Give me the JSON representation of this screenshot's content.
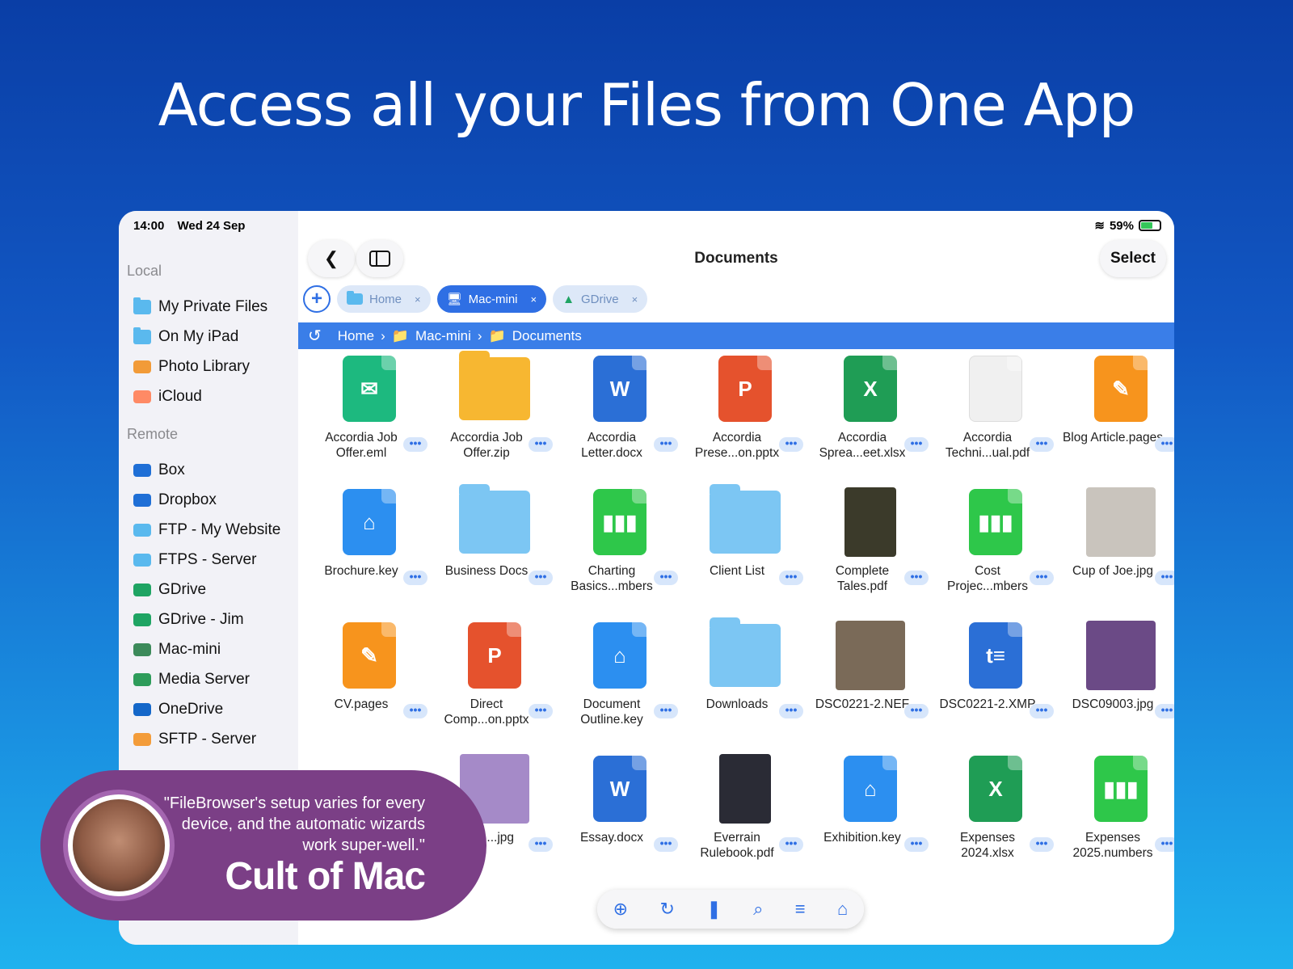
{
  "headline": "Access all your Files from One App",
  "status": {
    "time": "14:00",
    "date": "Wed 24 Sep",
    "battery": "59%"
  },
  "sidebar": {
    "local_title": "Local",
    "local_items": [
      {
        "label": "My Private Files",
        "icon": "folder-icon"
      },
      {
        "label": "On My iPad",
        "icon": "folder-icon"
      },
      {
        "label": "Photo Library",
        "icon": "photos-icon"
      },
      {
        "label": "iCloud",
        "icon": "cloud-icon"
      }
    ],
    "remote_title": "Remote",
    "remote_items": [
      {
        "label": "Box",
        "icon": "box-icon"
      },
      {
        "label": "Dropbox",
        "icon": "dropbox-icon"
      },
      {
        "label": "FTP - My Website",
        "icon": "ftp-icon"
      },
      {
        "label": "FTPS - Server",
        "icon": "ftps-icon"
      },
      {
        "label": "GDrive",
        "icon": "gdrive-icon"
      },
      {
        "label": "GDrive - Jim",
        "icon": "gdrive-icon"
      },
      {
        "label": "Mac-mini",
        "icon": "monitor-icon"
      },
      {
        "label": "Media Server",
        "icon": "media-server-icon"
      },
      {
        "label": "OneDrive",
        "icon": "onedrive-icon"
      },
      {
        "label": "SFTP - Server",
        "icon": "sftp-icon"
      }
    ]
  },
  "nav": {
    "title": "Documents",
    "select_label": "Select",
    "back_icon": "chevron-left-icon",
    "sidebar_icon": "sidebar-toggle-icon"
  },
  "tabs": [
    {
      "label": "Home",
      "close": "×"
    },
    {
      "label": "Mac-mini",
      "close": "×"
    },
    {
      "label": "GDrive",
      "close": "×"
    }
  ],
  "breadcrumb": [
    "Home",
    "Mac-mini",
    "Documents"
  ],
  "files": [
    {
      "name": "Accordia Job Offer.eml",
      "kind": "eml",
      "color": "#1db97f"
    },
    {
      "name": "Accordia Job Offer.zip",
      "kind": "zip",
      "color": "#f7b731"
    },
    {
      "name": "Accordia Letter.docx",
      "kind": "docx",
      "color": "#2b6fd6"
    },
    {
      "name": "Accordia Prese...on.pptx",
      "kind": "pptx",
      "color": "#e5522d"
    },
    {
      "name": "Accordia Sprea...eet.xlsx",
      "kind": "xlsx",
      "color": "#1f9d55"
    },
    {
      "name": "Accordia Techni...ual.pdf",
      "kind": "pdf",
      "color": "#f0f0f0"
    },
    {
      "name": "Blog Article.pages",
      "kind": "pages",
      "color": "#f7941d"
    },
    {
      "name": "Brochure.key",
      "kind": "key",
      "color": "#2c8ff0"
    },
    {
      "name": "Business Docs",
      "kind": "folder",
      "color": "#7cc6f3"
    },
    {
      "name": "Charting Basics...mbers",
      "kind": "numbers",
      "color": "#2ec74a"
    },
    {
      "name": "Client List",
      "kind": "folder",
      "color": "#7cc6f3"
    },
    {
      "name": "Complete Tales.pdf",
      "kind": "book",
      "color": "#3b3a2a"
    },
    {
      "name": "Cost Projec...mbers",
      "kind": "numbers",
      "color": "#2ec74a"
    },
    {
      "name": "Cup of Joe.jpg",
      "kind": "photo",
      "color": "#c9c4bd"
    },
    {
      "name": "CV.pages",
      "kind": "pages",
      "color": "#f7941d"
    },
    {
      "name": "Direct Comp...on.pptx",
      "kind": "pptx",
      "color": "#e5522d"
    },
    {
      "name": "Document Outline.key",
      "kind": "key",
      "color": "#2c8ff0"
    },
    {
      "name": "Downloads",
      "kind": "folder",
      "color": "#7cc6f3"
    },
    {
      "name": "DSC0221-2.NEF",
      "kind": "photo",
      "color": "#7a6a58"
    },
    {
      "name": "DSC0221-2.XMP",
      "kind": "xmp",
      "color": "#2b6fd6"
    },
    {
      "name": "DSC09003.jpg",
      "kind": "photo",
      "color": "#6b4a86"
    },
    {
      "name": "",
      "kind": "hidden",
      "color": "#1db97f"
    },
    {
      "name": "...on ...jpg",
      "kind": "photo",
      "color": "#a58ac8"
    },
    {
      "name": "Essay.docx",
      "kind": "docx",
      "color": "#2b6fd6"
    },
    {
      "name": "Everrain Rulebook.pdf",
      "kind": "book",
      "color": "#2a2b35"
    },
    {
      "name": "Exhibition.key",
      "kind": "key",
      "color": "#2c8ff0"
    },
    {
      "name": "Expenses 2024.xlsx",
      "kind": "xlsx",
      "color": "#1f9d55"
    },
    {
      "name": "Expenses 2025.numbers",
      "kind": "numbers",
      "color": "#2ec74a"
    }
  ],
  "more_label": "•••",
  "toolbar": [
    "add-icon",
    "refresh-icon",
    "bookmark-icon",
    "search-icon",
    "sort-icon",
    "home-icon"
  ],
  "quote": {
    "text": "\"FileBrowser's setup varies for every device, and the automatic wizards work super-well.\"",
    "brand": "Cult of Mac"
  }
}
